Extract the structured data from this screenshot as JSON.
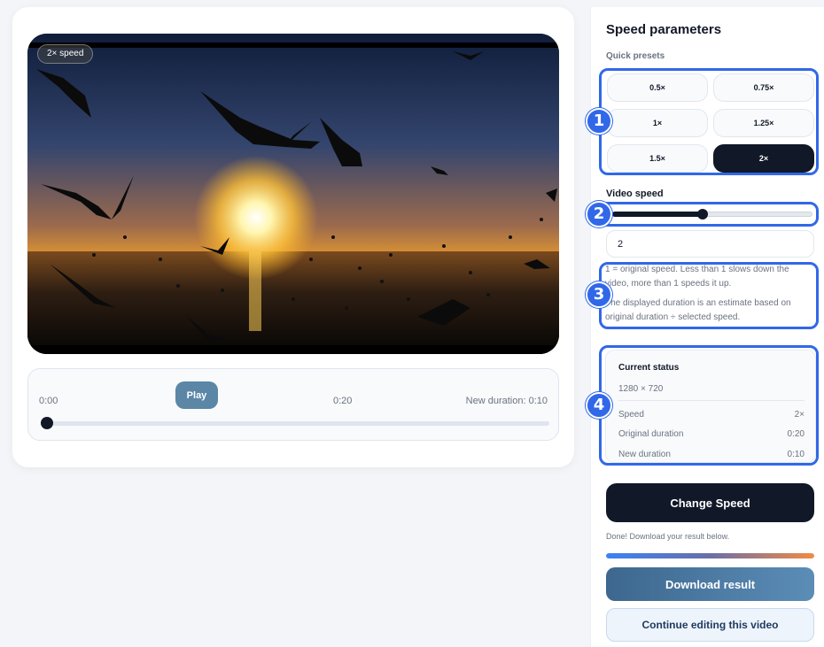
{
  "video": {
    "badge": "2× speed",
    "controls": {
      "current_time": "0:00",
      "play_label": "Play",
      "duration": "0:20",
      "new_duration": "New duration: 0:10",
      "seek_progress": 0
    }
  },
  "panel": {
    "title": "Speed parameters",
    "presets_label": "Quick presets",
    "presets": [
      "0.5×",
      "0.75×",
      "1×",
      "1.25×",
      "1.5×",
      "2×"
    ],
    "active_preset": "2×",
    "video_speed_label": "Video speed",
    "slider_fraction": 0.45,
    "speed_input_value": "2",
    "help": [
      "1 = original speed. Less than 1 slows down the video, more than 1 speeds it up.",
      "The displayed duration is an estimate based on original duration ÷ selected speed."
    ],
    "status": {
      "title": "Current status",
      "resolution": "1280 × 720",
      "rows": [
        {
          "label": "Speed",
          "value": "2×"
        },
        {
          "label": "Original duration",
          "value": "0:20"
        },
        {
          "label": "New duration",
          "value": "0:10"
        }
      ]
    },
    "change_button": "Change Speed",
    "done_text": "Done! Download your result below.",
    "progress_fraction": 1.0,
    "download_button": "Download result",
    "continue_button": "Continue editing this video"
  },
  "annotations": [
    "1",
    "2",
    "3",
    "4"
  ],
  "colors": {
    "accent": "#3168e8",
    "dark": "#111827",
    "play": "#5b86a6",
    "download": "#4a78a3"
  }
}
